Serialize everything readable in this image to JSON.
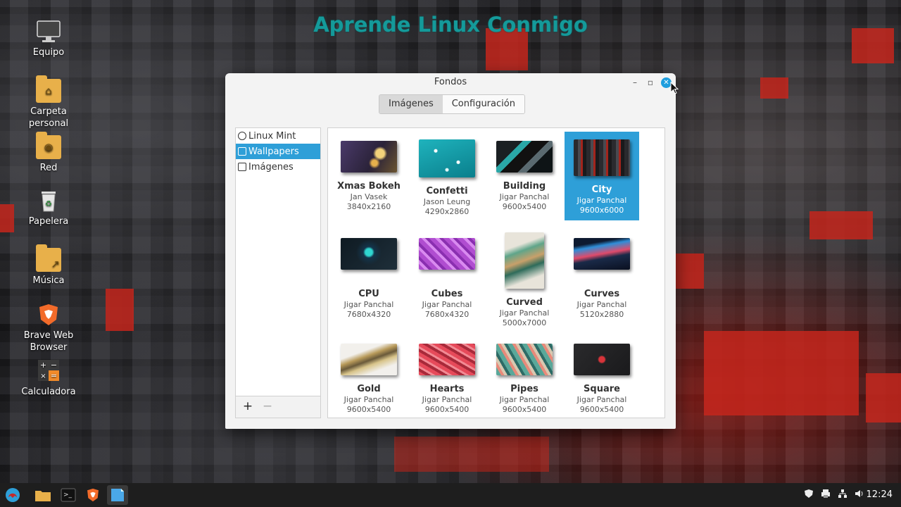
{
  "desktop": {
    "banner": "Aprende Linux Conmigo",
    "icons": [
      {
        "label": "Equipo",
        "icon": "computer-icon"
      },
      {
        "label": "Carpeta personal",
        "icon": "home-folder-icon"
      },
      {
        "label": "Red",
        "icon": "network-folder-icon"
      },
      {
        "label": "Papelera",
        "icon": "trash-icon"
      },
      {
        "label": "Música",
        "icon": "music-folder-icon"
      },
      {
        "label": "Brave Web Browser",
        "icon": "brave-browser-icon"
      },
      {
        "label": "Calculadora",
        "icon": "calculator-icon"
      }
    ]
  },
  "window": {
    "title": "Fondos",
    "controls": {
      "minimize": "–",
      "maximize": "▫",
      "close": "✕"
    },
    "tabs": [
      {
        "label": "Imágenes",
        "active": true
      },
      {
        "label": "Configuración",
        "active": false
      }
    ],
    "sidebar": {
      "items": [
        {
          "label": "Linux Mint",
          "selected": false
        },
        {
          "label": "Wallpapers",
          "selected": true
        },
        {
          "label": "Imágenes",
          "selected": false
        }
      ],
      "add_label": "+",
      "remove_label": "−"
    },
    "wallpapers": [
      {
        "name": "Xmas Bokeh",
        "author": "Jan Vasek",
        "size": "3840x2160",
        "selected": false
      },
      {
        "name": "Confetti",
        "author": "Jason Leung",
        "size": "4290x2860",
        "selected": false
      },
      {
        "name": "Building",
        "author": "Jigar Panchal",
        "size": "9600x5400",
        "selected": false
      },
      {
        "name": "City",
        "author": "Jigar Panchal",
        "size": "9600x6000",
        "selected": true
      },
      {
        "name": "CPU",
        "author": "Jigar Panchal",
        "size": "7680x4320",
        "selected": false
      },
      {
        "name": "Cubes",
        "author": "Jigar Panchal",
        "size": "7680x4320",
        "selected": false
      },
      {
        "name": "Curved",
        "author": "Jigar Panchal",
        "size": "5000x7000",
        "selected": false
      },
      {
        "name": "Curves",
        "author": "Jigar Panchal",
        "size": "5120x2880",
        "selected": false
      },
      {
        "name": "Gold",
        "author": "Jigar Panchal",
        "size": "9600x5400",
        "selected": false
      },
      {
        "name": "Hearts",
        "author": "Jigar Panchal",
        "size": "9600x5400",
        "selected": false
      },
      {
        "name": "Pipes",
        "author": "Jigar Panchal",
        "size": "9600x5400",
        "selected": false
      },
      {
        "name": "Square",
        "author": "Jigar Panchal",
        "size": "9600x5400",
        "selected": false
      }
    ]
  },
  "taskbar": {
    "apps": [
      "menu-icon",
      "files-icon",
      "terminal-icon",
      "brave-browser-icon",
      "wallpaper-app-icon"
    ],
    "tray": [
      "shield-icon",
      "printer-icon",
      "network-icon",
      "volume-icon"
    ],
    "clock": "12:24"
  },
  "colors": {
    "accent": "#2e9fd8",
    "banner": "#149a9a",
    "folder": "#e8b04a"
  }
}
